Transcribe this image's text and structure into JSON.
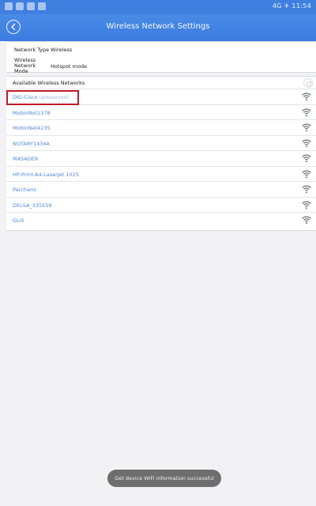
{
  "status_bar": {
    "right_text": "4G ✈ 11:54"
  },
  "header": {
    "title": "Wireless Network Settings"
  },
  "info": {
    "rows": [
      {
        "label": "Network Type",
        "value": "Wireless"
      },
      {
        "label": "Wireless Network Mode",
        "value": "Hotspot mode"
      }
    ]
  },
  "networks": {
    "header": "Available Wireless Networks",
    "items": [
      {
        "name": "DIG-Cisco",
        "note": "(preserved)"
      },
      {
        "name": "MobinNet1378"
      },
      {
        "name": "MobinNet4235"
      },
      {
        "name": "NOTARY1434A"
      },
      {
        "name": "MASADER"
      },
      {
        "name": "HP-Print-A4-LaserJet 1025"
      },
      {
        "name": "Parchami"
      },
      {
        "name": "DELSA_335E59"
      },
      {
        "name": "GLIS"
      }
    ]
  },
  "toast": {
    "text": "Get device WiFi information successful"
  },
  "colors": {
    "header_bg": "#3e7fe0",
    "network_text": "#4f86d6",
    "highlight": "#c0192a",
    "toast_bg": "#6e6e6e"
  }
}
